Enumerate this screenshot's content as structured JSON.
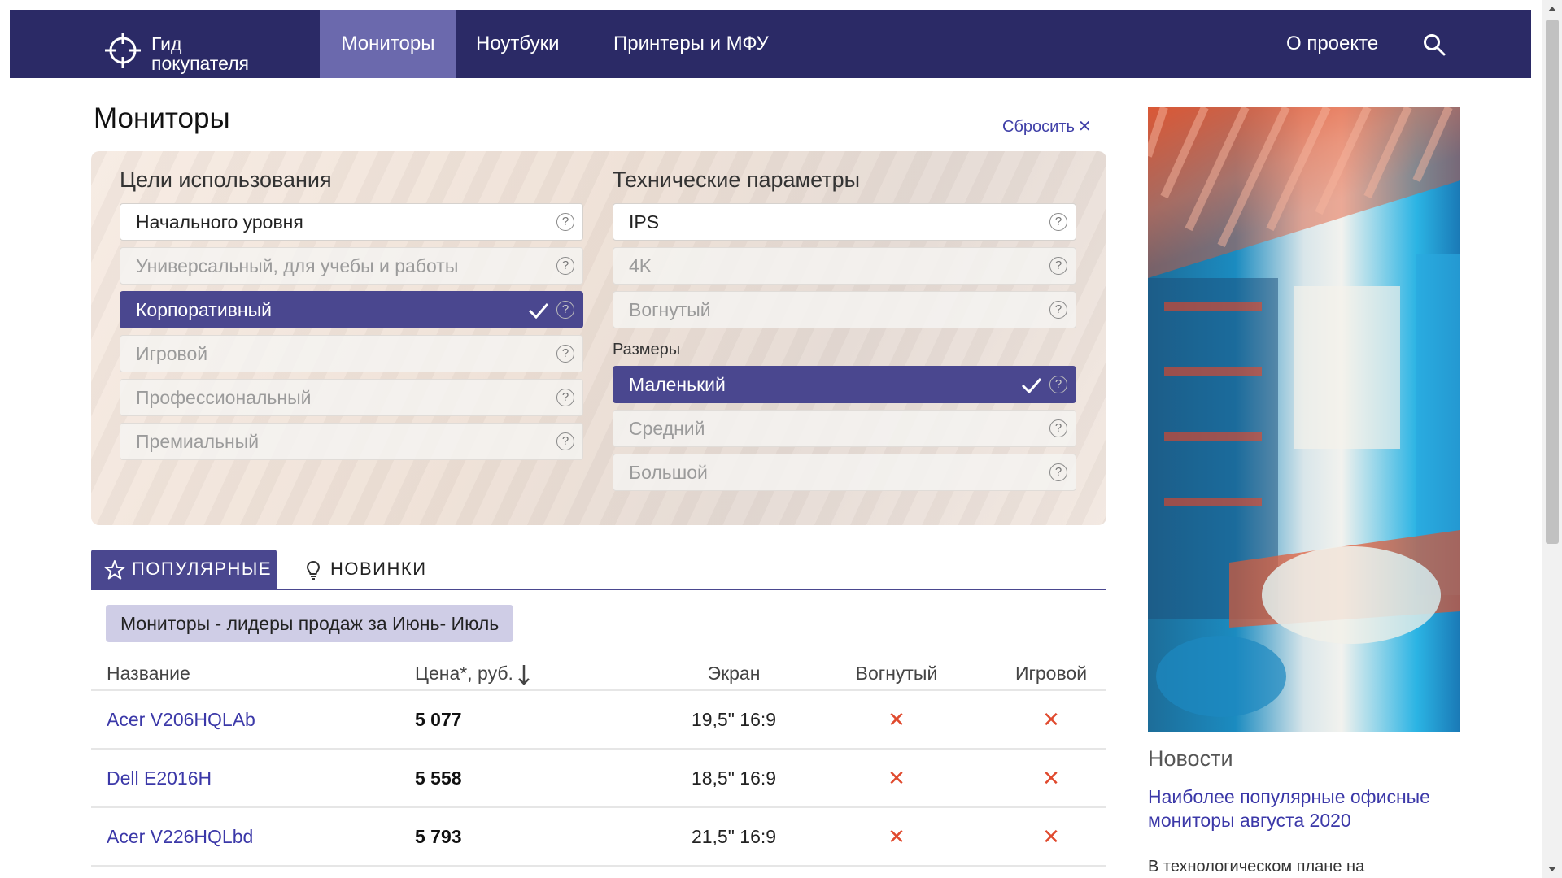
{
  "nav": {
    "logo_line1": "Гид",
    "logo_line2": "покупателя",
    "items": [
      {
        "label": "Мониторы",
        "active": true
      },
      {
        "label": "Ноутбуки",
        "active": false
      },
      {
        "label": "Принтеры и МФУ",
        "active": false
      }
    ],
    "about": "О проекте",
    "search_icon": "search-icon"
  },
  "page": {
    "title": "Мониторы",
    "reset_label": "Сбросить",
    "reset_icon": "close-icon"
  },
  "filters": {
    "usage": {
      "title": "Цели использования",
      "options": [
        {
          "label": "Начального уровня",
          "state": "enabled"
        },
        {
          "label": "Универсальный, для учебы и работы",
          "state": "disabled"
        },
        {
          "label": "Корпоративный",
          "state": "selected"
        },
        {
          "label": "Игровой",
          "state": "disabled"
        },
        {
          "label": "Профессиональный",
          "state": "disabled"
        },
        {
          "label": "Премиальный",
          "state": "disabled"
        }
      ]
    },
    "tech": {
      "title": "Технические параметры",
      "options": [
        {
          "label": "IPS",
          "state": "enabled"
        },
        {
          "label": "4K",
          "state": "disabled"
        },
        {
          "label": "Вогнутый",
          "state": "disabled"
        }
      ]
    },
    "sizes": {
      "title": "Размеры",
      "options": [
        {
          "label": "Маленький",
          "state": "selected"
        },
        {
          "label": "Средний",
          "state": "disabled"
        },
        {
          "label": "Большой",
          "state": "disabled"
        }
      ]
    },
    "help_glyph": "?"
  },
  "tabs": {
    "popular": "ПОПУЛЯРНЫЕ",
    "new": "НОВИНКИ",
    "popular_icon": "star-icon",
    "new_icon": "lightbulb-icon"
  },
  "leaders_label": "Мониторы - лидеры продаж за Июнь- Июль",
  "table": {
    "headers": {
      "name": "Название",
      "price": "Цена*, руб.",
      "screen": "Экран",
      "curved": "Вогнутый",
      "gaming": "Игровой"
    },
    "rows": [
      {
        "name": "Acer V206HQLAb",
        "price": "5 077",
        "screen": "19,5\" 16:9",
        "curved": "✕",
        "gaming": "✕"
      },
      {
        "name": "Dell E2016H",
        "price": "5 558",
        "screen": "18,5\" 16:9",
        "curved": "✕",
        "gaming": "✕"
      },
      {
        "name": "Acer V226HQLbd",
        "price": "5 793",
        "screen": "21,5\" 16:9",
        "curved": "✕",
        "gaming": "✕"
      }
    ]
  },
  "sidebar": {
    "news_title": "Новости",
    "news_link": "Наиболее популярные офисные мониторы августа 2020",
    "news_teaser": "В технологическом плане на"
  },
  "colors": {
    "navbar": "#2b2a66",
    "nav_active": "#6b69ad",
    "selected": "#4a478f",
    "link": "#3b38a8",
    "cross": "#e04a2e"
  }
}
